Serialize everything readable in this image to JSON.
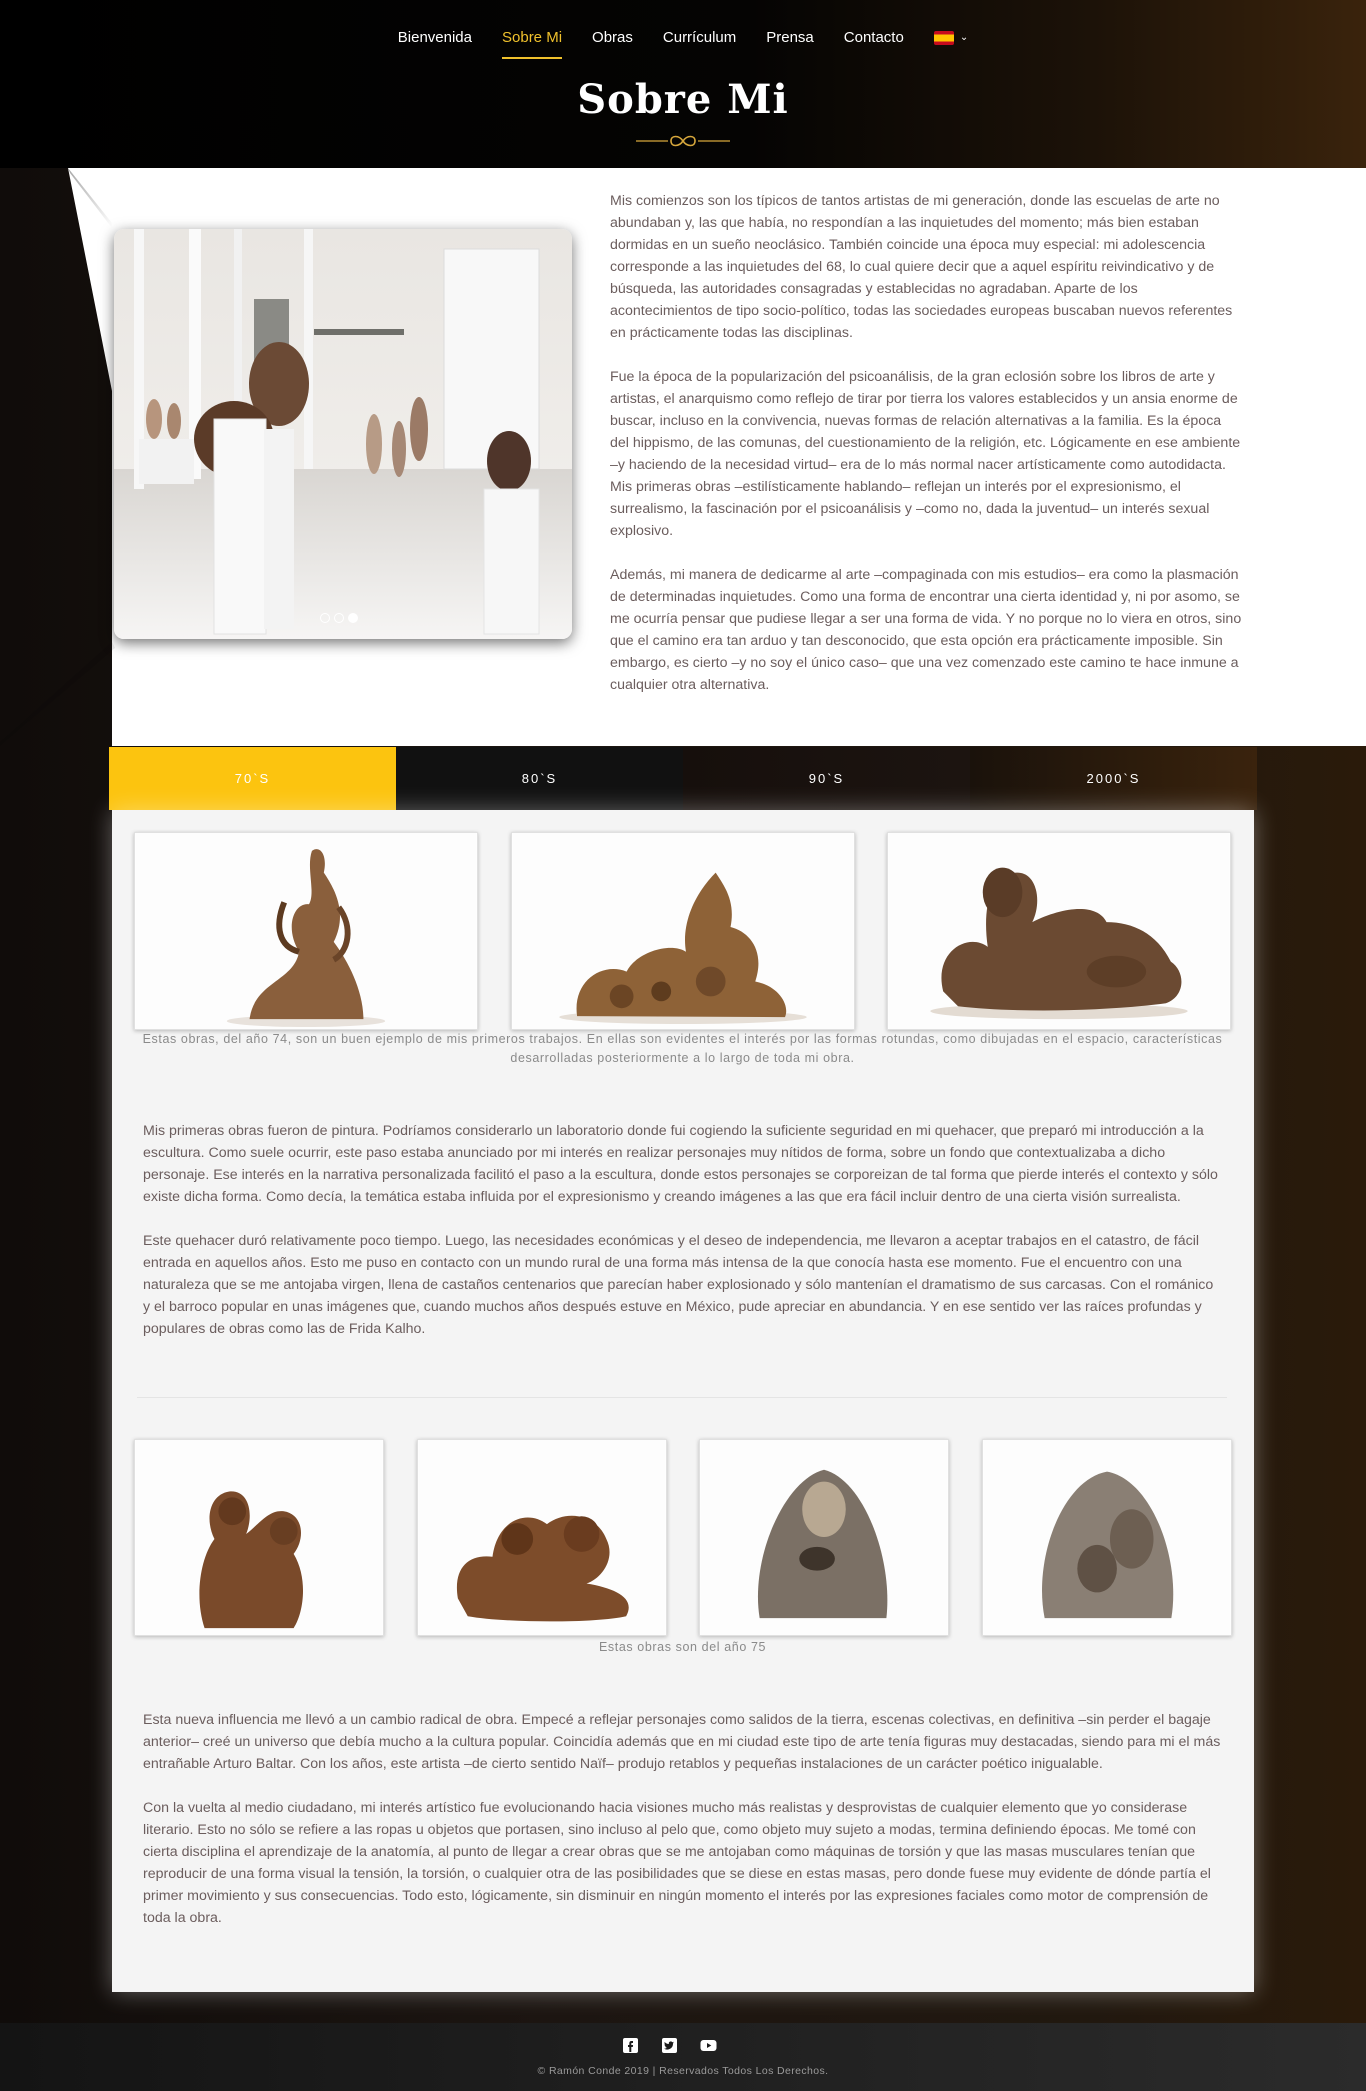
{
  "nav": {
    "items": [
      "Bienvenida",
      "Sobre Mi",
      "Obras",
      "Currículum",
      "Prensa",
      "Contacto"
    ],
    "active": "Sobre Mi",
    "language": "es"
  },
  "page": {
    "title": "Sobre Mi"
  },
  "about": {
    "paragraphs": [
      "Mis comienzos son los típicos de tantos artistas de mi generación, donde las escuelas de arte no abundaban y, las que había, no respondían a las inquietudes del momento; más bien estaban dormidas en un sueño neoclásico. También coincide una época muy especial: mi adolescencia corresponde a las inquietudes del 68, lo cual quiere decir que a aquel espíritu reivindicativo y de búsqueda, las autoridades consagradas y establecidas no agradaban. Aparte de los acontecimientos de tipo socio-político, todas las sociedades europeas buscaban nuevos referentes en prácticamente todas las disciplinas.",
      "Fue la época de la popularización del psicoanálisis, de la gran eclosión sobre los libros de arte y artistas, el anarquismo como reflejo de tirar por tierra los valores establecidos y un ansia enorme de buscar, incluso en la convivencia, nuevas formas de relación alternativas a la familia. Es la época del hippismo, de las comunas, del cuestionamiento de la religión, etc. Lógicamente en ese ambiente –y haciendo de la necesidad virtud– era de lo más normal nacer artísticamente como autodidacta. Mis primeras obras –estilísticamente hablando– reflejan un interés por el expresionismo, el surrealismo, la fascinación por el psicoanálisis y –como no, dada la juventud– un interés sexual explosivo.",
      "Además, mi manera de dedicarme al arte –compaginada con mis estudios– era como la plasmación de determinadas inquietudes. Como una forma de encontrar una cierta identidad y, ni por asomo, se me ocurría pensar que pudiese llegar a ser una forma de vida. Y no porque no lo viera en otros, sino que el camino era tan arduo y tan desconocido, que esta opción era prácticamente imposible. Sin embargo, es cierto –y no soy el único caso– que una vez comenzado este camino te hace inmune a cualquier otra alternativa."
    ],
    "slider": {
      "slides": 3,
      "active": 3
    }
  },
  "tabs": [
    "70`S",
    "80`S",
    "90`S",
    "2000`S"
  ],
  "active_tab": "70`S",
  "section70s": {
    "gallery1_caption": "Estas obras, del año 74, son un buen ejemplo de mis primeros trabajos. En ellas son evidentes el interés por las formas rotundas, como dibujadas en el espacio, características desarrolladas posteriormente a lo largo de toda mi obra.",
    "text1": [
      "Mis primeras obras fueron de pintura. Podríamos considerarlo un laboratorio donde fui cogiendo la suficiente seguridad en mi quehacer, que preparó mi introducción a la escultura. Como suele ocurrir, este paso estaba anunciado por mi interés en realizar personajes muy nítidos de forma, sobre un fondo que contextualizaba a dicho personaje. Ese interés en la narrativa personalizada facilitó el paso a la escultura, donde estos personajes se corporeizan de tal forma que pierde interés el contexto y sólo existe dicha forma. Como decía, la temática estaba influida por el expresionismo y creando imágenes a las que era fácil incluir dentro de una cierta visión surrealista.",
      "Este quehacer duró relativamente poco tiempo. Luego, las necesidades económicas y el deseo de independencia, me llevaron a aceptar trabajos en el catastro, de fácil entrada en aquellos años. Esto me puso en contacto con un mundo rural de una forma más intensa de la que conocía hasta ese momento. Fue el encuentro con una naturaleza que se me antojaba virgen, llena de castaños centenarios que parecían haber explosionado y sólo mantenían el dramatismo de sus carcasas. Con el románico y el barroco popular en unas imágenes que, cuando muchos años después estuve en México, pude apreciar en abundancia. Y en ese sentido ver las raíces profundas y populares de obras como las de Frida Kalho."
    ],
    "gallery2_caption": "Estas obras son del año 75",
    "text2": [
      "Esta nueva influencia me llevó a un cambio radical de obra. Empecé a reflejar personajes como salidos de la tierra, escenas colectivas, en definitiva –sin perder el bagaje anterior– creé un universo que debía mucho a la cultura popular. Coincidía además que en mi ciudad este tipo de arte tenía figuras muy destacadas, siendo para mi el más entrañable Arturo Baltar. Con los años, este artista –de cierto sentido Naïf– produjo retablos y pequeñas instalaciones de un carácter poético inigualable.",
      "Con la vuelta al medio ciudadano, mi interés artístico fue evolucionando hacia visiones mucho más realistas y desprovistas de cualquier elemento que yo considerase literario. Esto no sólo se refiere a las ropas u objetos que portasen, sino incluso al pelo que, como objeto muy sujeto a modas, termina definiendo épocas. Me tomé con cierta disciplina el aprendizaje de la anatomía, al punto de llegar a crear obras que se me antojaban como máquinas de torsión y que las masas musculares tenían que reproducir de una forma visual la tensión, la torsión, o cualquier otra de las posibilidades que se diese en estas masas, pero donde fuese muy evidente de dónde partía el primer movimiento y sus consecuencias. Todo esto, lógicamente, sin disminuir en ningún momento el interés por las expresiones faciales como motor de comprensión de toda la obra."
    ]
  },
  "footer": {
    "social": [
      "facebook-icon",
      "twitter-icon",
      "youtube-icon"
    ],
    "copyright": "© Ramón Conde 2019 | Reservados Todos Los Derechos."
  },
  "colors": {
    "accent": "#fcc40f",
    "text": "#6b5d5d",
    "panel": "#f4f4f4"
  }
}
